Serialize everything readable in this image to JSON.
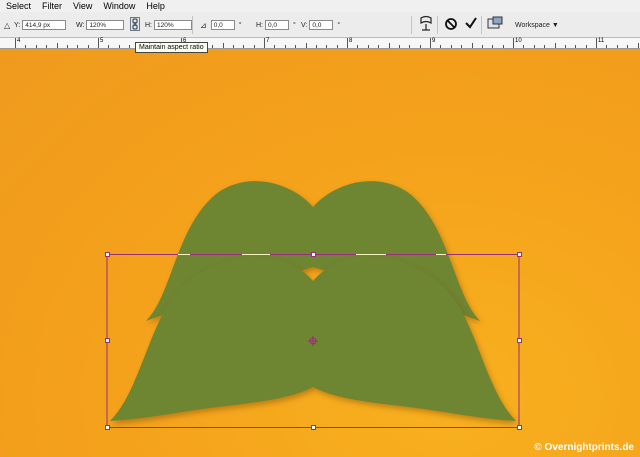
{
  "menu": [
    "Select",
    "Filter",
    "View",
    "Window",
    "Help"
  ],
  "options": {
    "y_label": "Y:",
    "y_value": "414,9 px",
    "w_label": "W:",
    "w_value": "120%",
    "h_label": "H:",
    "h_value": "120%",
    "rotate_value": "0,0",
    "rotate_unit": "°",
    "hskew_label": "H:",
    "hskew_value": "0,0",
    "hskew_unit": "°",
    "vskew_label": "V:",
    "vskew_value": "0,0",
    "vskew_unit": "°",
    "workspace_label": "Workspace ▼"
  },
  "ruler_ticks": [
    "4",
    "5",
    "6",
    "7",
    "8",
    "9",
    "10",
    "11"
  ],
  "tooltip": "Maintain aspect ratio",
  "copyright": "© Overnightprints.de",
  "colors": {
    "canvas": "#f4a11c",
    "mustache": "#6e8533",
    "selection": "#9b2d7a",
    "menubar": "#f0f0f0"
  },
  "icons": [
    "triangle-icon",
    "link-icon",
    "angle-icon",
    "warp-icon",
    "cancel-icon",
    "commit-icon",
    "bridge-icon"
  ]
}
